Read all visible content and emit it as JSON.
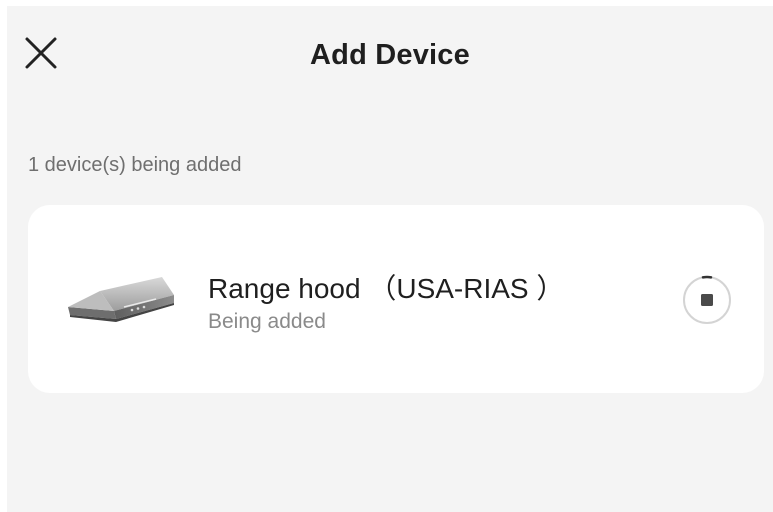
{
  "header": {
    "title": "Add Device",
    "close_icon": "close-icon"
  },
  "status": {
    "count_text": "1 device(s) being added"
  },
  "device": {
    "name": "Range hood （USA-RIAS ）",
    "status": "Being added",
    "image": "range-hood-image",
    "action_icon": "stop-progress-icon"
  },
  "colors": {
    "background": "#f4f4f4",
    "card": "#ffffff",
    "title_text": "#1f1f1f",
    "secondary_text": "#8a8a8a"
  }
}
